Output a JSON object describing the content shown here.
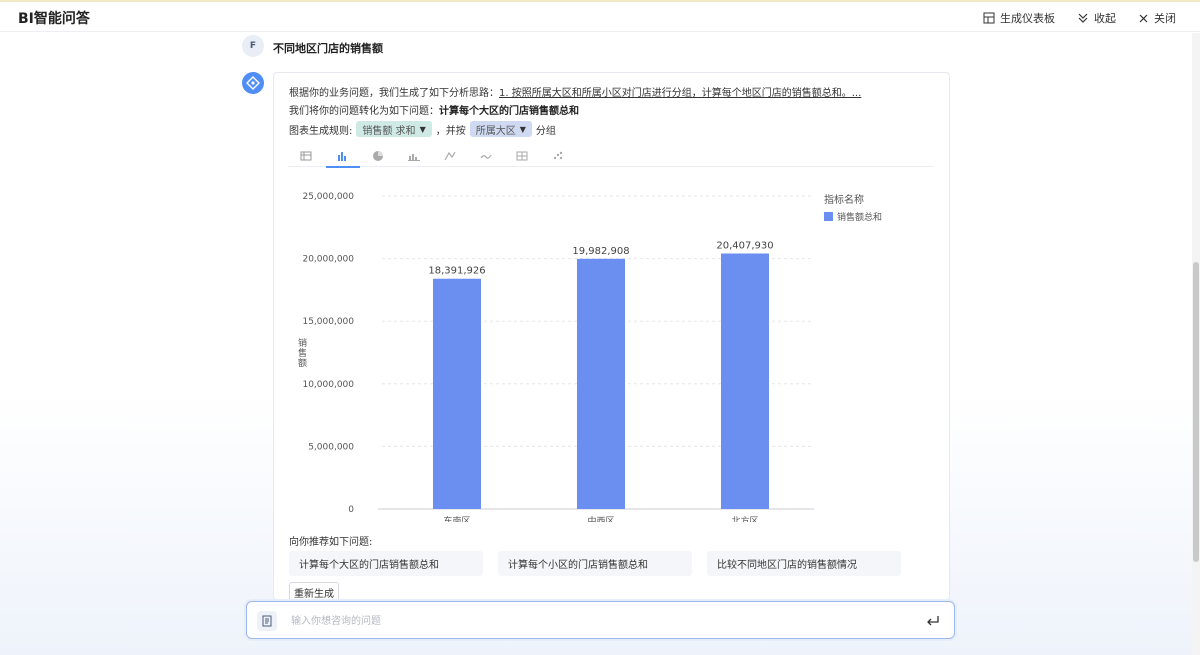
{
  "header": {
    "title": "BI智能问答",
    "actions": [
      {
        "label": "生成仪表板",
        "icon": "dashboard-icon"
      },
      {
        "label": "收起",
        "icon": "collapse-icon"
      },
      {
        "label": "关闭",
        "icon": "close-icon"
      }
    ]
  },
  "conversation": {
    "user_avatar": "F",
    "user_question": "不同地区门店的销售额",
    "answer": {
      "line1_prefix": "根据你的业务问题，我们生成了如下分析思路：",
      "line1_link": "1. 按照所属大区和所属小区对门店进行分组，计算每个地区门店的销售额总和。...",
      "line2_prefix": "我们将你的问题转化为如下问题：",
      "line2_bold": "计算每个大区的门店销售额总和",
      "rule_prefix": "图表生成规则:",
      "metric_chip": "销售额 求和",
      "rule_mid": "，并按",
      "dimension_chip": "所属大区",
      "rule_suffix": "分组"
    }
  },
  "chart_tabs": [
    {
      "icon": "table-icon"
    },
    {
      "icon": "bar-chart-icon",
      "active": true
    },
    {
      "icon": "pie-chart-icon"
    },
    {
      "icon": "column-group-icon"
    },
    {
      "icon": "line-chart-icon"
    },
    {
      "icon": "area-chart-icon"
    },
    {
      "icon": "grid-chart-icon"
    },
    {
      "icon": "scatter-chart-icon"
    }
  ],
  "chart_data": {
    "type": "bar",
    "categories": [
      "东南区",
      "中西区",
      "北方区"
    ],
    "series": [
      {
        "name": "销售额总和",
        "values": [
          18391926,
          19982908,
          20407930
        ]
      }
    ],
    "data_labels": [
      "18,391,926",
      "19,982,908",
      "20,407,930"
    ],
    "ylabel": "销售额",
    "ylim": [
      0,
      25000000
    ],
    "yticks": [
      0,
      5000000,
      10000000,
      15000000,
      20000000,
      25000000
    ],
    "ytick_labels": [
      "0",
      "5,000,000",
      "10,000,000",
      "15,000,000",
      "20,000,000",
      "25,000,000"
    ],
    "legend_title": "指标名称",
    "legend_position": "top-right",
    "grid": true,
    "bar_color": "#6b8ff0"
  },
  "recommend": {
    "label": "向你推荐如下问题:",
    "items": [
      "计算每个大区的门店销售额总和",
      "计算每个小区的门店销售额总和",
      "比较不同地区门店的销售额情况"
    ],
    "regenerate_label": "重新生成"
  },
  "input": {
    "placeholder": "输入你想咨询的问题"
  }
}
